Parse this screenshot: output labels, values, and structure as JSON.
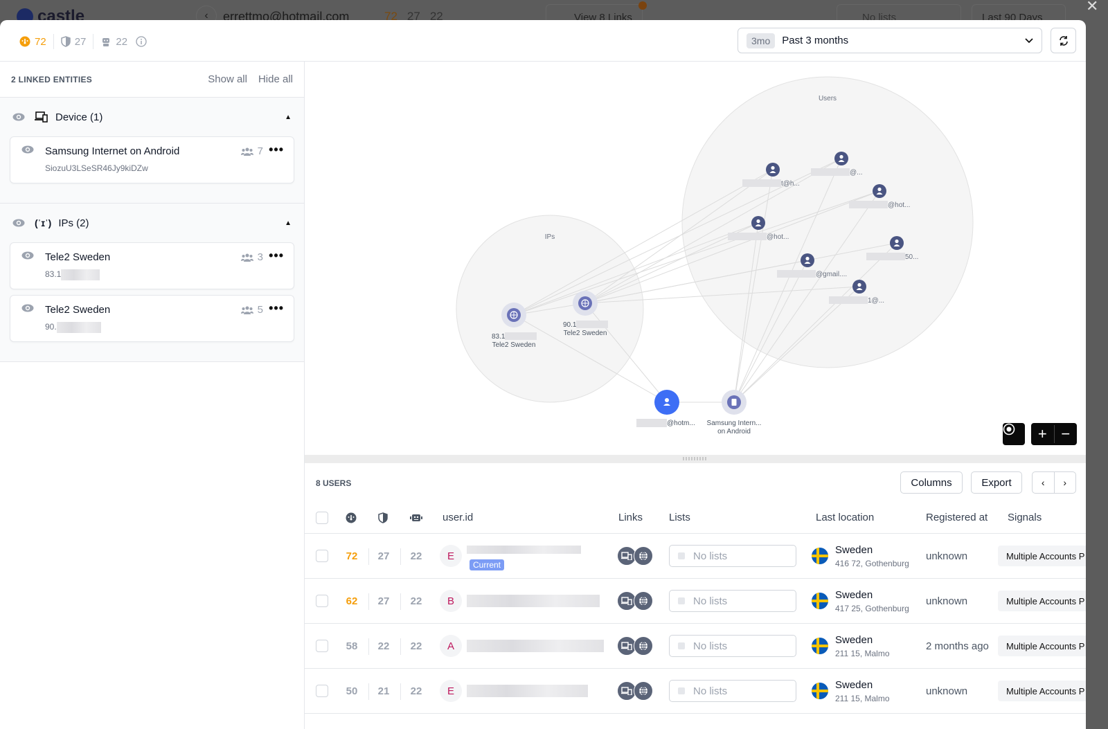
{
  "background": {
    "logo": "castle",
    "email": "errettmo@hotmail.com",
    "scores": [
      "72",
      "27",
      "22"
    ],
    "links_button": "View 8 Links",
    "lists_placeholder": "No lists",
    "days_select": "Last 90 Days"
  },
  "header": {
    "scores": {
      "risk": "72",
      "policy": "27",
      "bot": "22"
    },
    "range_pill": "3mo",
    "range_label": "Past 3 months"
  },
  "linked": {
    "title": "2 LINKED ENTITIES",
    "show_all": "Show all",
    "hide_all": "Hide all",
    "groups": [
      {
        "label": "Device (1)",
        "icon": "devices-icon",
        "items": [
          {
            "name": "Samsung Internet on Android",
            "sub": "SiozuU3LSeSR46Jy9kiDZw",
            "users": "7"
          }
        ]
      },
      {
        "label": "IPs (2)",
        "icon": "antenna-icon",
        "items": [
          {
            "name": "Tele2 Sweden",
            "sub": "83.1",
            "users": "3"
          },
          {
            "name": "Tele2 Sweden",
            "sub": "90.",
            "users": "5"
          }
        ]
      }
    ]
  },
  "graph": {
    "clusters": {
      "users": "Users",
      "ips": "IPs"
    },
    "user_nodes": [
      "t@h...",
      "@...",
      "@hot...",
      "@hot...",
      "@gmail....",
      "50...",
      "1@..."
    ],
    "ip_nodes": [
      {
        "ip": "83.1",
        "isp": "Tele2 Sweden"
      },
      {
        "ip": "90.1",
        "isp": "Tele2 Sweden"
      }
    ],
    "current_user": "@hotm...",
    "device": [
      "Samsung Intern...",
      "on Android"
    ]
  },
  "table": {
    "count": "8 USERS",
    "columns_btn": "Columns",
    "export_btn": "Export",
    "headers": {
      "user_id": "user.id",
      "links": "Links",
      "lists": "Lists",
      "location": "Last location",
      "registered": "Registered at",
      "signals": "Signals"
    },
    "rows": [
      {
        "risk": "72",
        "risk_hi": true,
        "policy": "27",
        "bot": "22",
        "initial": "E",
        "current": "Current",
        "lists": "No lists",
        "country": "Sweden",
        "city": "416 72, Gothenburg",
        "registered": "unknown",
        "signal": "Multiple Accounts P"
      },
      {
        "risk": "62",
        "risk_hi": true,
        "policy": "27",
        "bot": "22",
        "initial": "B",
        "current": "",
        "lists": "No lists",
        "country": "Sweden",
        "city": "417 25, Gothenburg",
        "registered": "unknown",
        "signal": "Multiple Accounts P"
      },
      {
        "risk": "58",
        "risk_hi": false,
        "policy": "22",
        "bot": "22",
        "initial": "A",
        "current": "",
        "lists": "No lists",
        "country": "Sweden",
        "city": "211 15, Malmo",
        "registered": "2 months ago",
        "signal": "Multiple Accounts P"
      },
      {
        "risk": "50",
        "risk_hi": false,
        "policy": "21",
        "bot": "22",
        "initial": "E",
        "current": "",
        "lists": "No lists",
        "country": "Sweden",
        "city": "211 15, Malmo",
        "registered": "unknown",
        "signal": "Multiple Accounts P"
      }
    ]
  }
}
